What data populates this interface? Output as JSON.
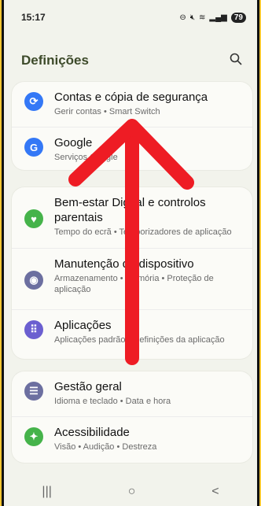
{
  "status_bar": {
    "time": "15:17",
    "battery": "79",
    "icons": [
      "dnd-icon",
      "mute-icon",
      "wifi-icon",
      "signal-icon"
    ]
  },
  "header": {
    "title": "Definições",
    "search_icon": "search-icon"
  },
  "colors": {
    "blue": "#3478f6",
    "green": "#45b34a",
    "purple": "#6b5fd0",
    "slate": "#6c6fa0"
  },
  "cards": [
    {
      "items": [
        {
          "title": "Contas e cópia de segurança",
          "subtitle": "Gerir contas • Smart Switch",
          "icon": "sync-icon"
        },
        {
          "title": "Google",
          "subtitle": "Serviços Google",
          "icon": "google-icon"
        }
      ]
    },
    {
      "items": [
        {
          "title": "Bem-estar Digital e controlos parentais",
          "subtitle": "Tempo do ecrã • Temporizadores de aplicação",
          "icon": "wellbeing-icon"
        },
        {
          "title": "Manutenção do dispositivo",
          "subtitle": "Armazenamento • Memória • Proteção de aplicação",
          "icon": "device-care-icon"
        },
        {
          "title": "Aplicações",
          "subtitle": "Aplicações padrão • Definições da aplicação",
          "icon": "apps-icon"
        }
      ]
    },
    {
      "items": [
        {
          "title": "Gestão geral",
          "subtitle": "Idioma e teclado • Data e hora",
          "icon": "general-management-icon"
        },
        {
          "title": "Acessibilidade",
          "subtitle": "Visão • Audição • Destreza",
          "icon": "accessibility-icon"
        }
      ]
    }
  ],
  "nav": {
    "recent": "|||",
    "home": "○",
    "back": "<"
  }
}
